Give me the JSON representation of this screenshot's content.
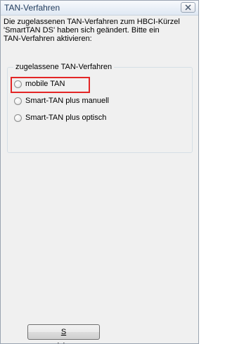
{
  "window": {
    "title": "TAN-Verfahren"
  },
  "description": "Die zugelassenen TAN-Verfahren zum HBCI-Kürzel\n'SmartTAN DS' haben sich geändert. Bitte ein\nTAN-Verfahren aktivieren:",
  "group": {
    "legend": "zugelassene TAN-Verfahren",
    "options": [
      {
        "label": "mobile TAN",
        "checked": false,
        "highlighted": true
      },
      {
        "label": "Smart-TAN plus manuell",
        "checked": false
      },
      {
        "label": "Smart-TAN plus optisch",
        "checked": false
      }
    ]
  },
  "save_button": {
    "mnemonic": "S",
    "rest": "peichern"
  },
  "colors": {
    "highlight": "#e32626",
    "title_text": "#1e395b"
  },
  "icons": {
    "close": "close-x-icon"
  }
}
